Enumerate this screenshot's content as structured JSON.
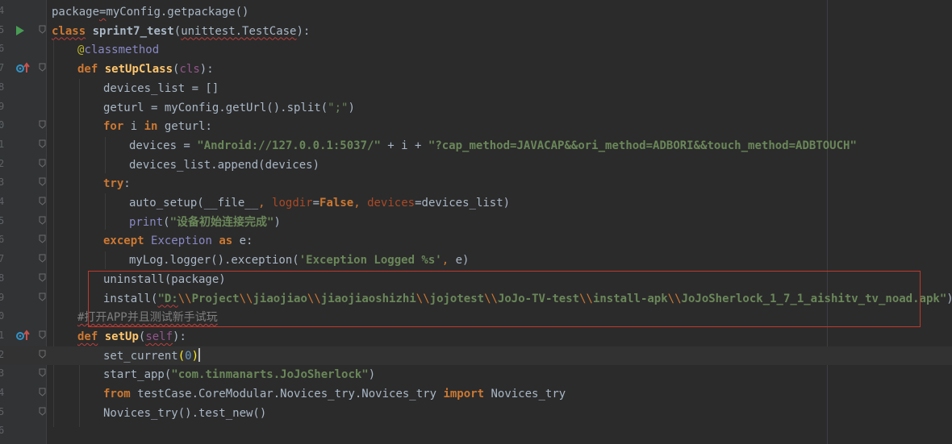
{
  "editor": {
    "theme_colors": {
      "background": "#2b2b2b",
      "gutter": "#313335",
      "keyword": "#cc7832",
      "string": "#6a8759",
      "highlight_box": "#c0392b"
    },
    "lines": [
      {
        "no": "4",
        "t": [
          [
            "",
            "package"
          ],
          [
            "",
            "="
          ],
          [
            "",
            "myConfig.getpackage()"
          ]
        ]
      },
      {
        "no": "5",
        "t": [
          [
            "kw",
            "class"
          ],
          [
            "",
            " "
          ],
          [
            "cls",
            "sprint7_test"
          ],
          [
            "",
            "("
          ],
          [
            "",
            "unittest.TestCase"
          ],
          [
            "",
            "):"
          ]
        ]
      },
      {
        "no": "6",
        "t": [
          [
            "deco",
            "@"
          ],
          [
            "bi",
            "classmethod"
          ]
        ]
      },
      {
        "no": "7",
        "t": [
          [
            "kw",
            "def"
          ],
          [
            "",
            " "
          ],
          [
            "fn",
            "setUpClass"
          ],
          [
            "",
            "("
          ],
          [
            "slf",
            "cls"
          ],
          [
            "",
            "):"
          ]
        ]
      },
      {
        "no": "8",
        "t": [
          [
            "",
            "devices_list = []"
          ]
        ]
      },
      {
        "no": "9",
        "t": [
          [
            "",
            "geturl = myConfig.getUrl().split("
          ],
          [
            "str",
            "\";\""
          ],
          [
            "",
            ")"
          ]
        ]
      },
      {
        "no": "0",
        "t": [
          [
            "kw",
            "for"
          ],
          [
            "",
            " i "
          ],
          [
            "kw",
            "in"
          ],
          [
            "",
            " geturl:"
          ]
        ]
      },
      {
        "no": "1",
        "t": [
          [
            "",
            "devices = "
          ],
          [
            "strb",
            "\"Android://127.0.0.1:5037/\""
          ],
          [
            "",
            " + i + "
          ],
          [
            "strb",
            "\"?cap_method=JAVACAP&&ori_method=ADBORI&&touch_method=ADBTOUCH\""
          ]
        ]
      },
      {
        "no": "2",
        "t": [
          [
            "",
            "devices_list.append(devices)"
          ]
        ]
      },
      {
        "no": "3",
        "t": [
          [
            "kw",
            "try"
          ],
          [
            "",
            ":"
          ]
        ]
      },
      {
        "no": "4",
        "t": [
          [
            "",
            "auto_setup(__file__"
          ],
          [
            "kwp",
            ","
          ],
          [
            "",
            " "
          ],
          [
            "par",
            "logdir"
          ],
          [
            "",
            "="
          ],
          [
            "kw",
            "False"
          ],
          [
            "kwp",
            ","
          ],
          [
            "",
            " "
          ],
          [
            "par",
            "devices"
          ],
          [
            "",
            "=devices_list)"
          ]
        ]
      },
      {
        "no": "5",
        "t": [
          [
            "bi",
            "print"
          ],
          [
            "",
            "("
          ],
          [
            "strb",
            "\"设备初始连接完成\""
          ],
          [
            "",
            ")"
          ]
        ]
      },
      {
        "no": "6",
        "t": [
          [
            "kw",
            "except"
          ],
          [
            "",
            " "
          ],
          [
            "bi",
            "Exception"
          ],
          [
            "",
            " "
          ],
          [
            "kw",
            "as"
          ],
          [
            "",
            " e:"
          ]
        ]
      },
      {
        "no": "7",
        "t": [
          [
            "",
            "myLog.logger().exception("
          ],
          [
            "strb",
            "'Exception Logged %s'"
          ],
          [
            "kwp",
            ","
          ],
          [
            "",
            " e)"
          ]
        ]
      },
      {
        "no": "8",
        "t": [
          [
            "",
            "uninstall(package)"
          ]
        ]
      },
      {
        "no": "9",
        "t": [
          [
            "",
            "install("
          ],
          [
            "strb",
            "\"D:"
          ],
          [
            "esc",
            "\\\\"
          ],
          [
            "strb",
            "Project"
          ],
          [
            "esc",
            "\\\\"
          ],
          [
            "strb",
            "jiaojiao"
          ],
          [
            "esc",
            "\\\\"
          ],
          [
            "strb",
            "jiaojiaoshizhi"
          ],
          [
            "esc",
            "\\\\"
          ],
          [
            "strb",
            "jojotest"
          ],
          [
            "esc",
            "\\\\"
          ],
          [
            "strb",
            "JoJo-TV-test"
          ],
          [
            "esc",
            "\\\\"
          ],
          [
            "strb",
            "install-apk"
          ],
          [
            "esc",
            "\\\\"
          ],
          [
            "strb",
            "JoJoSherlock_1_7_1_aishitv_tv_noad.apk\""
          ],
          [
            "",
            ")"
          ]
        ]
      },
      {
        "no": "0",
        "t": [
          [
            "cmt",
            "#打开APP并且测试新手试玩"
          ]
        ]
      },
      {
        "no": "1",
        "t": [
          [
            "kw",
            "def"
          ],
          [
            "",
            " "
          ],
          [
            "fn",
            "setUp"
          ],
          [
            "",
            "("
          ],
          [
            "slf",
            "self"
          ],
          [
            "",
            "):"
          ]
        ]
      },
      {
        "no": "2",
        "t": [
          [
            "",
            "set_current"
          ],
          [
            "paren-hl",
            "("
          ],
          [
            "num",
            "0"
          ],
          [
            "paren-hl",
            ")"
          ]
        ]
      },
      {
        "no": "3",
        "t": [
          [
            "",
            "start_app("
          ],
          [
            "strb",
            "\"com.tinmanarts.JoJoSherlock\""
          ],
          [
            "",
            ")"
          ]
        ]
      },
      {
        "no": "4",
        "t": [
          [
            "kw",
            "from"
          ],
          [
            "",
            " testCase.CoreModular.Novices_try.Novices_try "
          ],
          [
            "kw",
            "import"
          ],
          [
            "",
            " Novices_try"
          ]
        ]
      },
      {
        "no": "5",
        "t": [
          [
            "",
            "Novices_try().test_new()"
          ]
        ]
      },
      {
        "no": "6",
        "t": []
      }
    ]
  }
}
